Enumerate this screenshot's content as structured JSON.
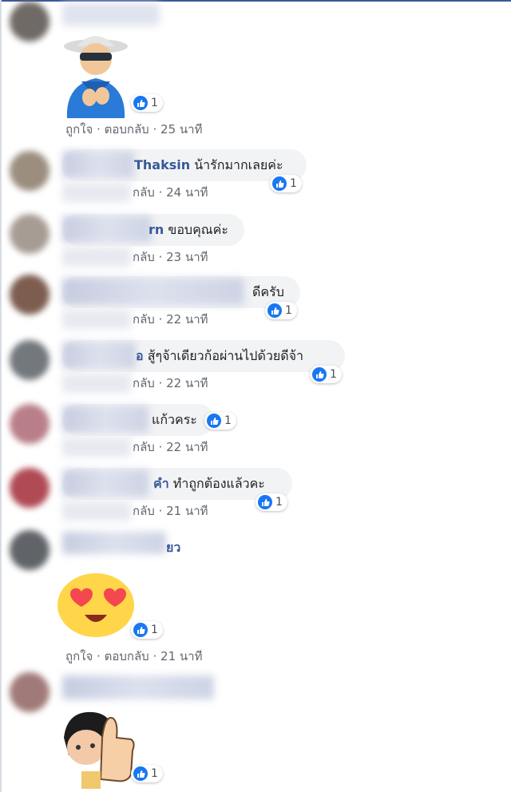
{
  "comments": [
    {
      "author": "",
      "text": "",
      "reactions": "1",
      "actions": {
        "like": "ถูกใจ",
        "reply": "ตอบกลับ",
        "sep": "·",
        "time": "25 นาที"
      },
      "sticker": "cool-grandpa-clapping-sticker"
    },
    {
      "author": "Thaksin",
      "text": "น้ารักมากเลยค่ะ",
      "reactions": "1",
      "actions": {
        "reply": "กลับ",
        "sep": "·",
        "time": "24 นาที"
      }
    },
    {
      "author": "rn",
      "text": "ขอบคุณค่ะ",
      "reactions": "",
      "actions": {
        "reply": "กลับ",
        "sep": "·",
        "time": "23 นาที"
      }
    },
    {
      "author": "",
      "text": "ดีครับ",
      "reactions": "1",
      "actions": {
        "reply": "กลับ",
        "sep": "·",
        "time": "22 นาที"
      }
    },
    {
      "author": "อ",
      "text": "สู้ๆจ้าเดียวก้อผ่านไปด้วยดีจ้า",
      "reactions": "1",
      "actions": {
        "reply": "กลับ",
        "sep": "·",
        "time": "22 นาที"
      }
    },
    {
      "author": "",
      "text": "แก้วคระ",
      "reactions": "1",
      "actions": {
        "reply": "กลับ",
        "sep": "·",
        "time": "22 นาที"
      }
    },
    {
      "author": "คำ",
      "text": "ทำถูกต้องแล้วคะ",
      "reactions": "1",
      "actions": {
        "reply": "กลับ",
        "sep": "·",
        "time": "21 นาที"
      }
    },
    {
      "author": "ยว",
      "text": "",
      "reactions": "1",
      "actions": {
        "like": "ถูกใจ",
        "reply": "ตอบกลับ",
        "sep": "·",
        "time": "21 นาที"
      },
      "sticker": "heart-eyes-emoji-sticker"
    },
    {
      "author": "",
      "text": "",
      "reactions": "1",
      "actions": {},
      "sticker": "thumbs-up-character-sticker"
    }
  ],
  "colors": {
    "author": "#385898",
    "bubble": "#f2f3f5",
    "like": "#1877f2",
    "meta": "#616770"
  }
}
